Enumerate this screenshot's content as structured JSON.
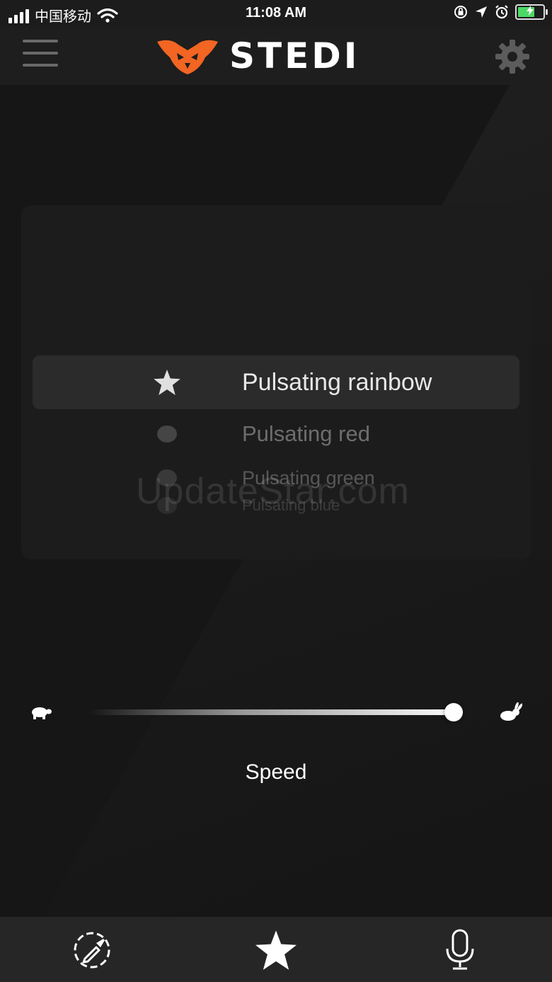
{
  "status_bar": {
    "carrier": "中国移动",
    "time": "11:08 AM",
    "battery_level": 0.75
  },
  "header": {
    "brand": "STEDI",
    "accent_color": "#f26522"
  },
  "picker": {
    "items": [
      {
        "label": "Pulsating rainbow",
        "icon": "star-icon"
      },
      {
        "label": "Pulsating red",
        "icon": "dot-icon"
      },
      {
        "label": "Pulsating green",
        "icon": "dot-icon"
      },
      {
        "label": "Pulsating blue",
        "icon": "dot-icon"
      }
    ],
    "selected_index": 0
  },
  "watermark": "UpdateStar.com",
  "speed": {
    "label": "Speed",
    "value": 1.0,
    "min_icon": "turtle-icon",
    "max_icon": "rabbit-icon"
  },
  "tab_bar": {
    "tabs": [
      {
        "icon": "color-picker-icon",
        "active": false
      },
      {
        "icon": "star-icon",
        "active": true
      },
      {
        "icon": "microphone-icon",
        "active": false
      }
    ]
  }
}
